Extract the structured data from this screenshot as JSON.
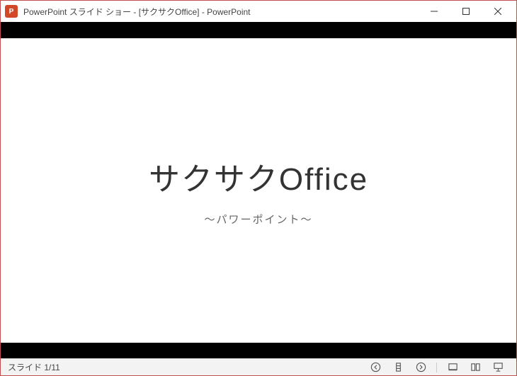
{
  "window": {
    "title": "PowerPoint スライド ショー - [サクサクOffice] - PowerPoint"
  },
  "slide": {
    "title": "サクサクOffice",
    "subtitle": "～パワーポイント～"
  },
  "status": {
    "counter": "スライド 1/11"
  }
}
